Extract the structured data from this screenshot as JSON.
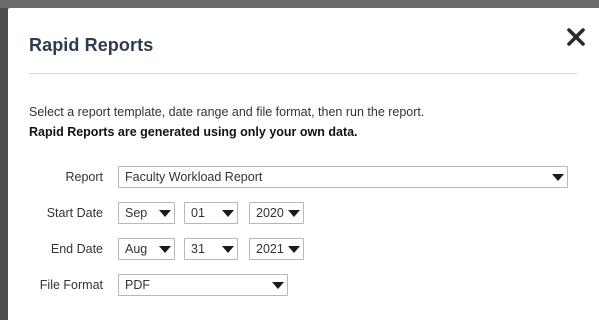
{
  "modal": {
    "title": "Rapid Reports",
    "description": "Select a report template, date range and file format, then run the report.",
    "note": "Rapid Reports are generated using only your own data.",
    "close_icon": "close-x-icon"
  },
  "form": {
    "report": {
      "label": "Report",
      "value": "Faculty Workload Report"
    },
    "start_date": {
      "label": "Start Date",
      "month": "Sep",
      "day": "01",
      "year": "2020"
    },
    "end_date": {
      "label": "End Date",
      "month": "Aug",
      "day": "31",
      "year": "2021"
    },
    "file_format": {
      "label": "File Format",
      "value": "PDF"
    }
  },
  "colors": {
    "title": "#2f3c4c",
    "border": "#b8b8b8",
    "overlay": "#5a5a5a"
  }
}
